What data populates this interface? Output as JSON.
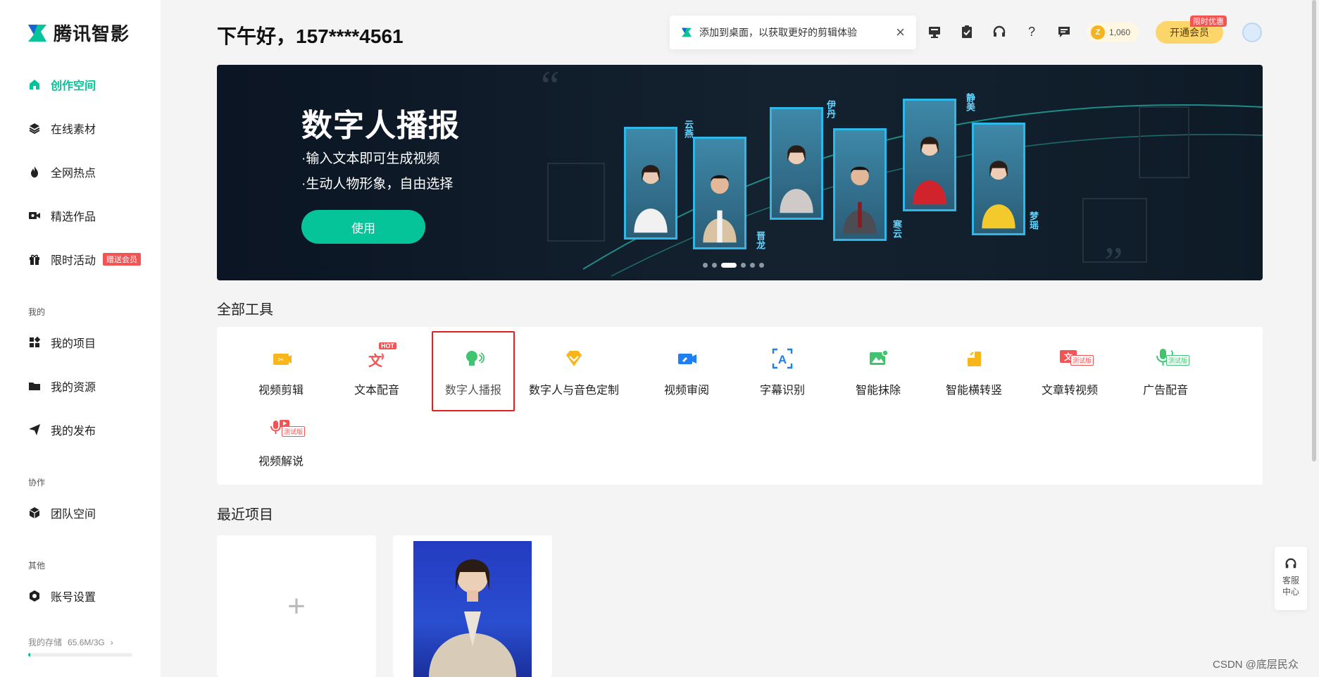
{
  "app": {
    "logo_text": "腾讯智影",
    "brand_color": "#06c49a"
  },
  "sidebar": {
    "nav": [
      {
        "label": "创作空间",
        "icon": "home-icon",
        "active": true
      },
      {
        "label": "在线素材",
        "icon": "layers-icon"
      },
      {
        "label": "全网热点",
        "icon": "flame-icon"
      },
      {
        "label": "精选作品",
        "icon": "video-camera-icon"
      },
      {
        "label": "限时活动",
        "icon": "gift-icon",
        "badge": "赠送会员"
      }
    ],
    "section_mine": "我的",
    "mine": [
      {
        "label": "我的项目",
        "icon": "grid-icon"
      },
      {
        "label": "我的资源",
        "icon": "folder-icon"
      },
      {
        "label": "我的发布",
        "icon": "send-icon"
      }
    ],
    "section_collab": "协作",
    "collab": [
      {
        "label": "团队空间",
        "icon": "cube-icon"
      }
    ],
    "section_other": "其他",
    "other": [
      {
        "label": "账号设置",
        "icon": "hexagon-settings-icon"
      }
    ],
    "storage_label": "我的存储",
    "storage_value": "65.6M/3G",
    "storage_fraction": 0.02
  },
  "header": {
    "greeting": "下午好，157****4561",
    "toast_text": "添加到桌面，以获取更好的剪辑体验",
    "coins": "1,060",
    "vip_label": "开通会员",
    "vip_tag": "限时优惠"
  },
  "banner": {
    "title": "数字人播报",
    "line1": "·输入文本即可生成视频",
    "line2": "·生动人物形象，自由选择",
    "button": "使用",
    "slide_count": 6,
    "active_slide": 2,
    "names": [
      "云燕",
      "晋龙",
      "伊丹",
      "寒云",
      "静美",
      "梦瑶"
    ]
  },
  "tools": {
    "section_title": "全部工具",
    "items": [
      {
        "label": "视频剪辑",
        "icon": "video-edit-icon"
      },
      {
        "label": "文本配音",
        "icon": "text-voice-icon",
        "tag": "HOT"
      },
      {
        "label": "数字人播报",
        "icon": "digital-human-icon",
        "selected": true
      },
      {
        "label": "数字人与音色定制",
        "icon": "diamond-icon"
      },
      {
        "label": "视频审阅",
        "icon": "video-review-icon"
      },
      {
        "label": "字幕识别",
        "icon": "subtitle-recognize-icon"
      },
      {
        "label": "智能抹除",
        "icon": "image-erase-icon"
      },
      {
        "label": "智能横转竖",
        "icon": "rotate-frame-icon"
      },
      {
        "label": "文章转视频",
        "icon": "article-video-icon",
        "beta": "测试版"
      },
      {
        "label": "广告配音",
        "icon": "ad-voice-icon",
        "beta": "测试版"
      },
      {
        "label": "视频解说",
        "icon": "video-narration-icon",
        "beta": "测试版"
      }
    ]
  },
  "recent": {
    "section_title": "最近项目",
    "new_symbol": "+"
  },
  "service": {
    "label": "客服中心"
  },
  "watermark": "CSDN @底层民众"
}
